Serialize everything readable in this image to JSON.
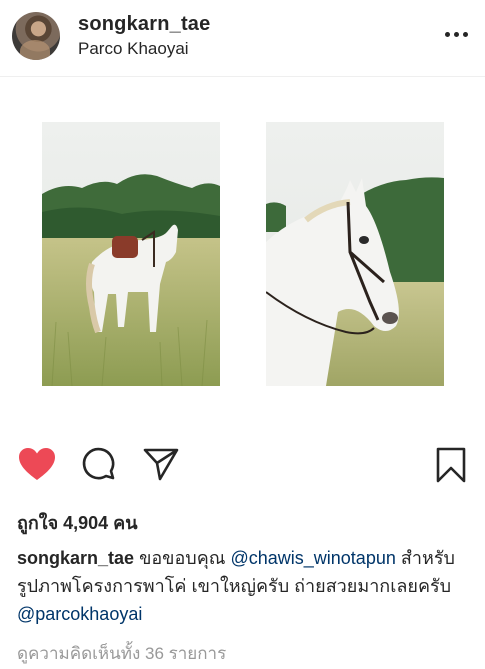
{
  "header": {
    "username": "songkarn_tae",
    "location": "Parco Khaoyai"
  },
  "post": {
    "photos": [
      "horse-in-field-left",
      "horse-head-closeup-right"
    ]
  },
  "actions": {
    "liked": true,
    "like_color": "#ed4956"
  },
  "likes": {
    "text": "ถูกใจ 4,904 คน"
  },
  "caption": {
    "username": "songkarn_tae",
    "part1": "ขอขอบคุณ",
    "mention1": "@chawis_winotapun",
    "part2": "สำหรับรูปภาพโครงการพาโค่ เขาใหญ่ครับ ถ่ายสวยมากเลยครับ",
    "mention2": "@parcokhaoyai"
  },
  "comments": {
    "view_all": "ดูความคิดเห็นทั้ง 36 รายการ"
  }
}
